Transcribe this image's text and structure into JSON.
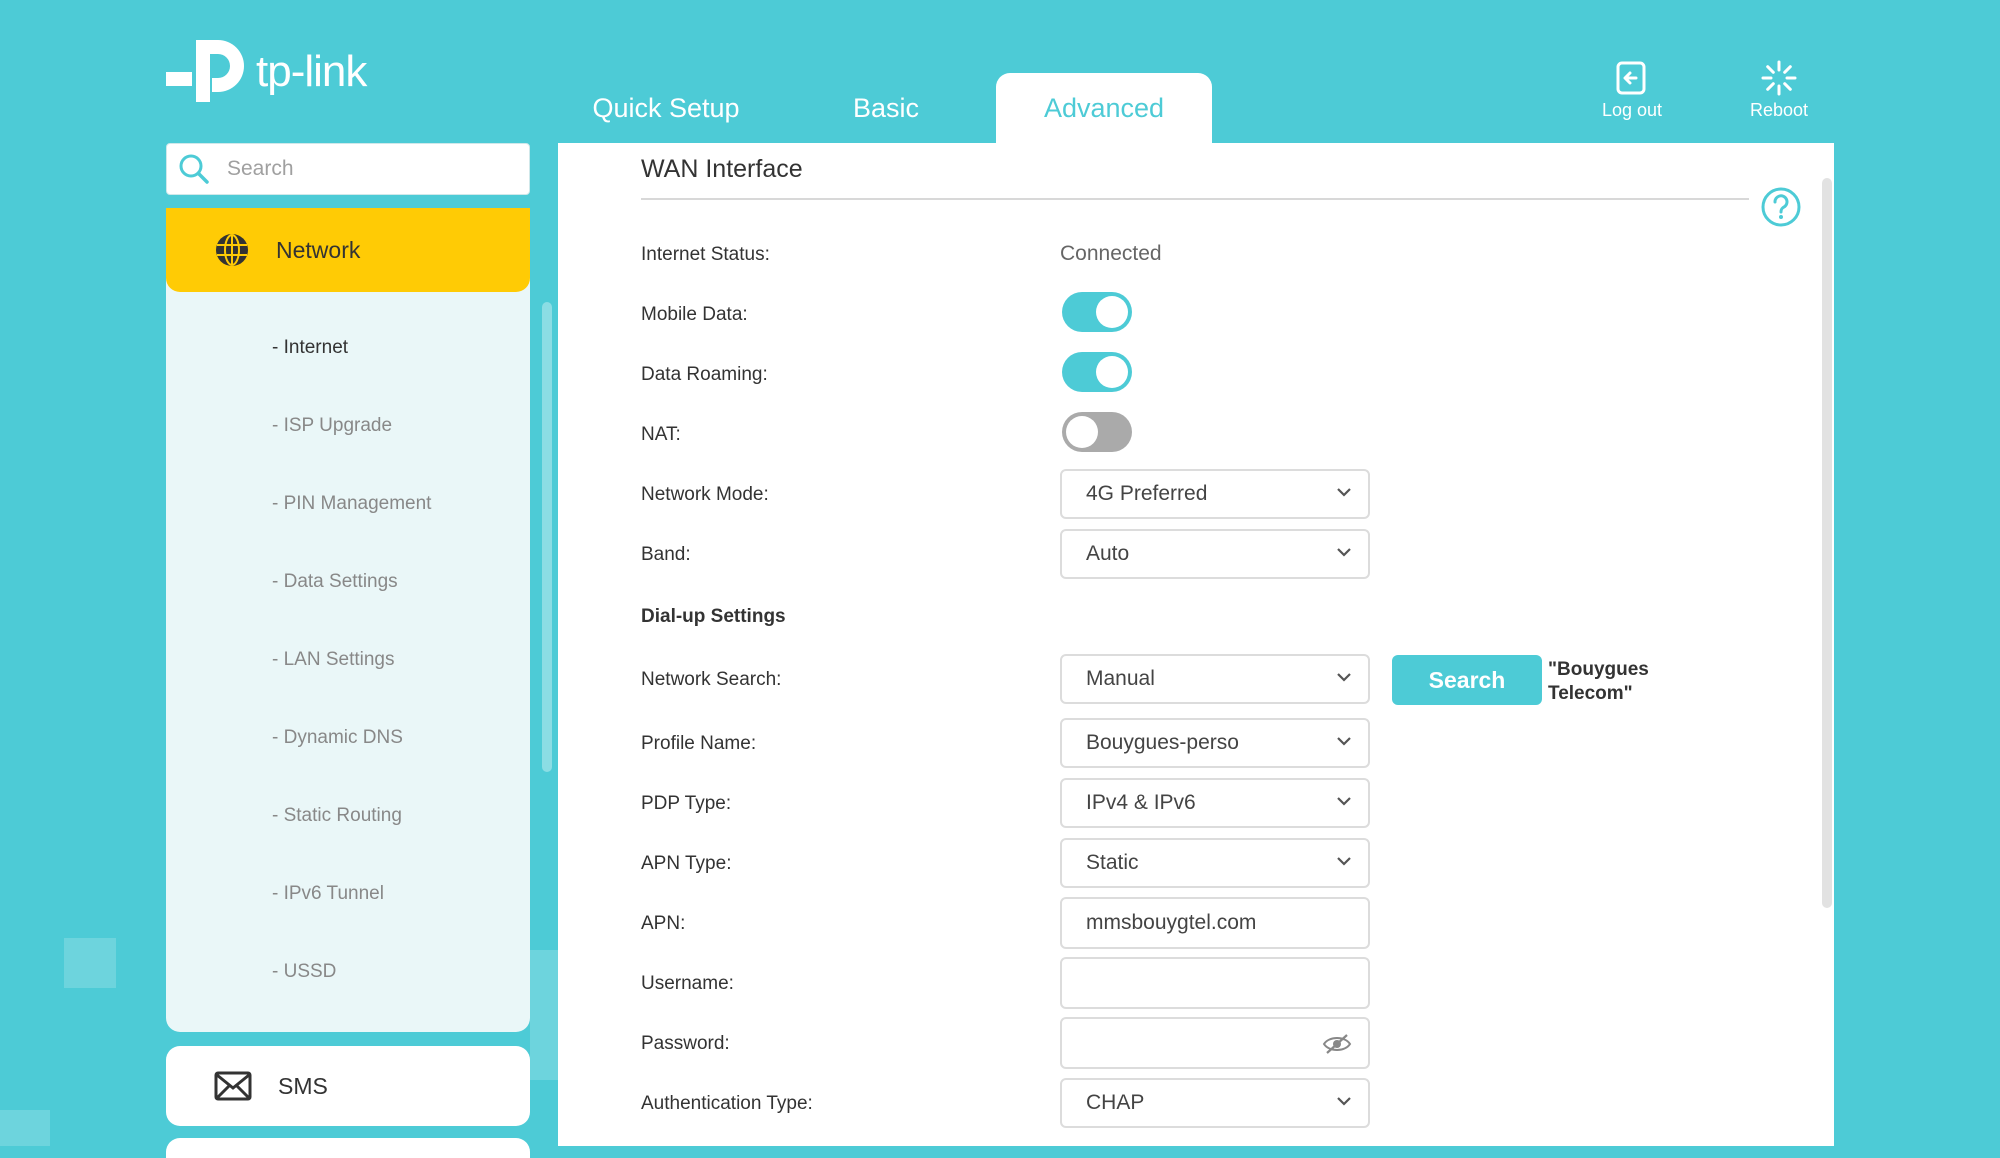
{
  "brand": {
    "logo_text": "tp-link",
    "accent": "#4dcbd6",
    "highlight": "#ffcb05"
  },
  "nav": {
    "tabs": [
      {
        "label": "Quick Setup",
        "active": false
      },
      {
        "label": "Basic",
        "active": false
      },
      {
        "label": "Advanced",
        "active": true
      }
    ]
  },
  "top_actions": {
    "logout": {
      "label": "Log out",
      "icon": "logout-icon"
    },
    "reboot": {
      "label": "Reboot",
      "icon": "reboot-icon"
    }
  },
  "sidebar": {
    "search_placeholder": "Search",
    "network": {
      "label": "Network",
      "icon": "globe-icon"
    },
    "items": [
      {
        "label": "- Internet",
        "active": true
      },
      {
        "label": "- ISP Upgrade",
        "active": false
      },
      {
        "label": "- PIN Management",
        "active": false
      },
      {
        "label": "- Data Settings",
        "active": false
      },
      {
        "label": "- LAN Settings",
        "active": false
      },
      {
        "label": "- Dynamic DNS",
        "active": false
      },
      {
        "label": "- Static Routing",
        "active": false
      },
      {
        "label": "- IPv6 Tunnel",
        "active": false
      },
      {
        "label": "- USSD",
        "active": false
      }
    ],
    "sms": {
      "label": "SMS",
      "icon": "envelope-icon"
    }
  },
  "main": {
    "section_title": "WAN Interface",
    "internet_status": {
      "label": "Internet Status:",
      "value": "Connected"
    },
    "mobile_data": {
      "label": "Mobile Data:",
      "on": true
    },
    "data_roaming": {
      "label": "Data Roaming:",
      "on": true
    },
    "nat": {
      "label": "NAT:",
      "on": false
    },
    "network_mode": {
      "label": "Network Mode:",
      "value": "4G Preferred"
    },
    "band": {
      "label": "Band:",
      "value": "Auto"
    },
    "dialup_heading": "Dial-up Settings",
    "network_search": {
      "label": "Network Search:",
      "value": "Manual",
      "button": "Search",
      "note": "\"Bouygues Telecom\""
    },
    "profile_name": {
      "label": "Profile Name:",
      "value": "Bouygues-perso"
    },
    "pdp_type": {
      "label": "PDP Type:",
      "value": "IPv4 & IPv6"
    },
    "apn_type": {
      "label": "APN Type:",
      "value": "Static"
    },
    "apn": {
      "label": "APN:",
      "value": "mmsbouygtel.com"
    },
    "username": {
      "label": "Username:",
      "value": ""
    },
    "password": {
      "label": "Password:",
      "value": ""
    },
    "auth_type": {
      "label": "Authentication Type:",
      "value": "CHAP"
    }
  }
}
